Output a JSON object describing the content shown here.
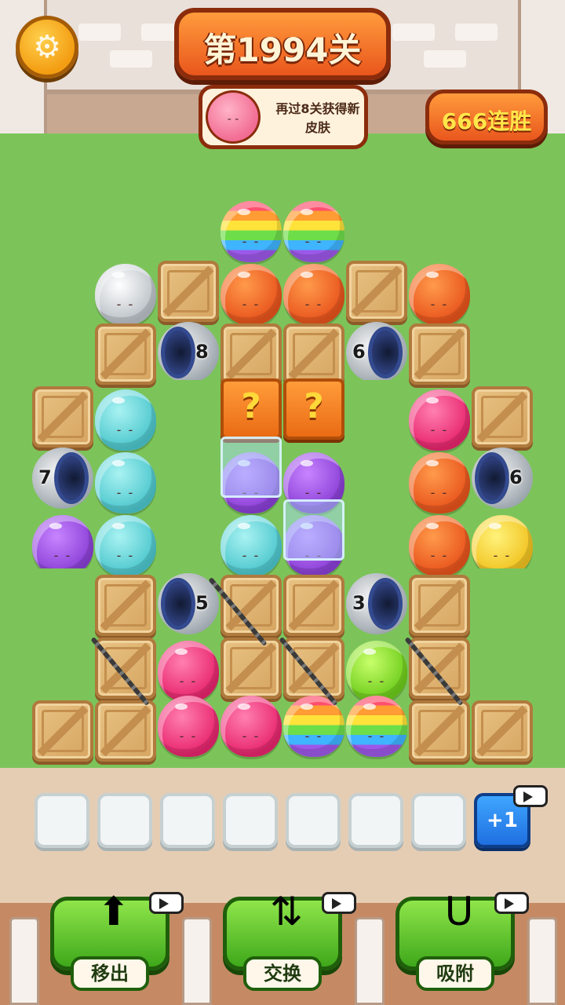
{
  "header": {
    "level_title": "第1994关",
    "reward_text": "再过8关获得新皮肤",
    "streak": "666连胜"
  },
  "board": {
    "pipes": [
      {
        "count": "8"
      },
      {
        "count": "6"
      },
      {
        "count": "7"
      },
      {
        "count": "6"
      },
      {
        "count": "5"
      },
      {
        "count": "3"
      }
    ],
    "mystery_mark": "?",
    "ball_face": "- -"
  },
  "tray": {
    "empty_slots": 7,
    "extra_slot_label": "+1"
  },
  "boosters": [
    {
      "label": "移出",
      "icon": "cards-up-arrow-icon"
    },
    {
      "label": "交换",
      "icon": "swap-arrows-icon"
    },
    {
      "label": "吸附",
      "icon": "magnet-icon"
    }
  ],
  "colors": {
    "grass": "#7cc45a",
    "orange_ui": "#e9561d",
    "tray_blue": "#1f6fe0",
    "booster_green": "#3fa81b"
  }
}
